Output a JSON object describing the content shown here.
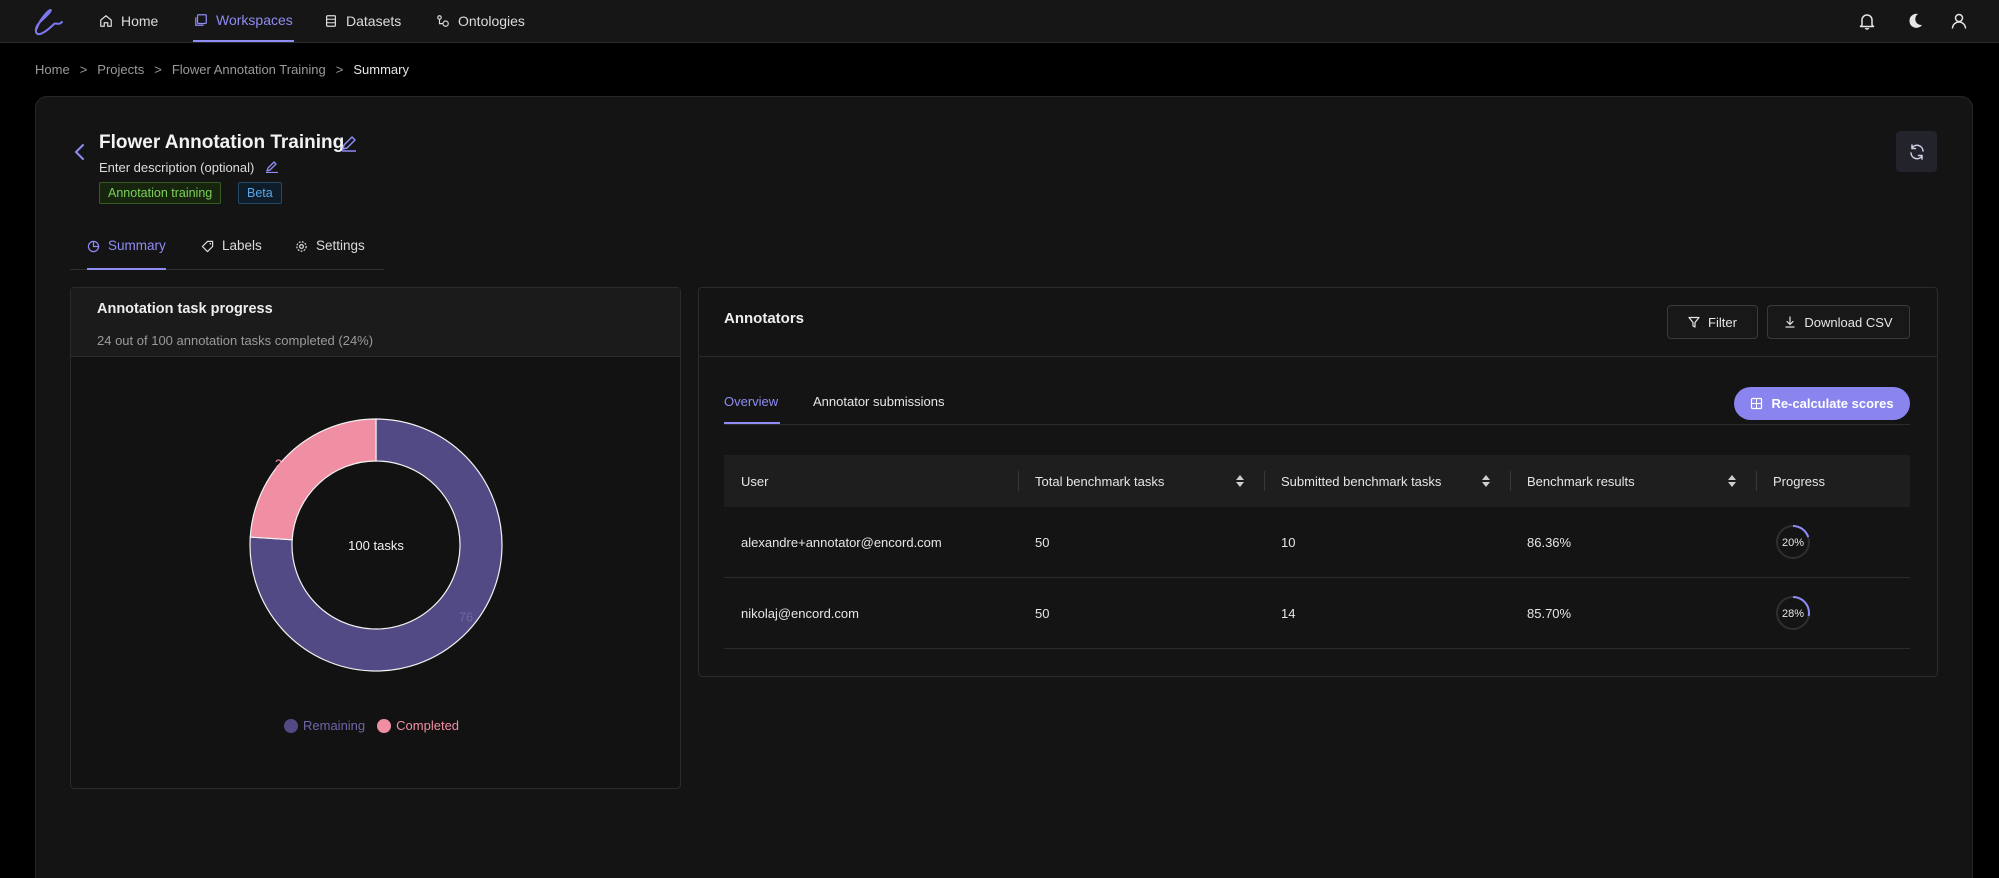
{
  "nav": {
    "items": [
      {
        "label": "Home",
        "icon": "home-icon"
      },
      {
        "label": "Workspaces",
        "icon": "workspaces-icon",
        "active": true
      },
      {
        "label": "Datasets",
        "icon": "datasets-icon"
      },
      {
        "label": "Ontologies",
        "icon": "ontologies-icon"
      }
    ]
  },
  "breadcrumb": {
    "items": [
      "Home",
      "Projects",
      "Flower Annotation Training",
      "Summary"
    ],
    "separator": ">"
  },
  "project": {
    "title": "Flower Annotation Training",
    "description": "Enter description (optional)",
    "tags": [
      "Annotation training",
      "Beta"
    ]
  },
  "tabs": [
    {
      "label": "Summary",
      "active": true
    },
    {
      "label": "Labels"
    },
    {
      "label": "Settings"
    }
  ],
  "progress": {
    "title": "Annotation task progress",
    "subtitle": "24 out of 100 annotation tasks completed (24%)",
    "center_label": "100 tasks"
  },
  "chart_data": {
    "type": "pie",
    "categories": [
      "Remaining",
      "Completed"
    ],
    "values": [
      76,
      24
    ],
    "colors": [
      "#514a84",
      "#f08ea4"
    ],
    "legend": "bottom"
  },
  "annotators": {
    "title": "Annotators",
    "filter_label": "Filter",
    "download_label": "Download CSV",
    "subtabs": [
      "Overview",
      "Annotator submissions"
    ],
    "recalc_label": "Re-calculate scores",
    "columns": [
      "User",
      "Total benchmark tasks",
      "Submitted benchmark tasks",
      "Benchmark results",
      "Progress"
    ],
    "rows": [
      {
        "user": "alexandre+annotator@encord.com",
        "total": "50",
        "submitted": "10",
        "result": "86.36%",
        "progress": 20,
        "progress_label": "20%"
      },
      {
        "user": "nikolaj@encord.com",
        "total": "50",
        "submitted": "14",
        "result": "85.70%",
        "progress": 28,
        "progress_label": "28%"
      }
    ]
  },
  "colors": {
    "accent": "#8f8cf5",
    "remaining": "#514a84",
    "completed": "#f08ea4"
  }
}
